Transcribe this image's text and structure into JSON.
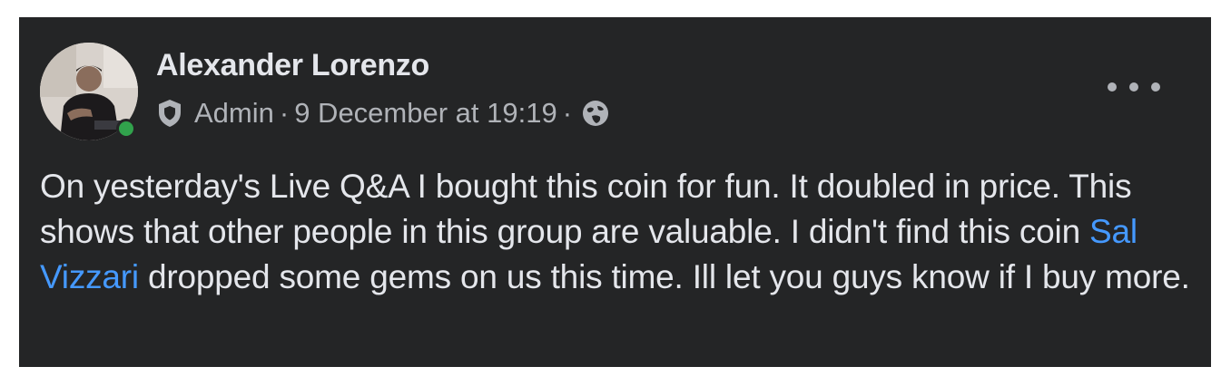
{
  "post": {
    "author": "Alexander Lorenzo",
    "role": "Admin",
    "separator": "·",
    "timestamp": "9 December at 19:19",
    "audience_icon": "globe-icon",
    "role_icon": "shield-icon",
    "menu_icon": "more-options-icon",
    "online": true,
    "body": {
      "text_before": "On yesterday's Live Q&A I bought this coin for fun. It doubled in price. This shows that other people in this group are valuable. I didn't find this coin ",
      "mention": "Sal Vizzari",
      "text_after": " dropped some gems on us this time. Ill let you guys know if I buy more."
    }
  },
  "colors": {
    "background": "#242526",
    "text": "#e4e6eb",
    "secondary_text": "#b0b3b8",
    "mention": "#4599ff",
    "online": "#31a24c"
  }
}
